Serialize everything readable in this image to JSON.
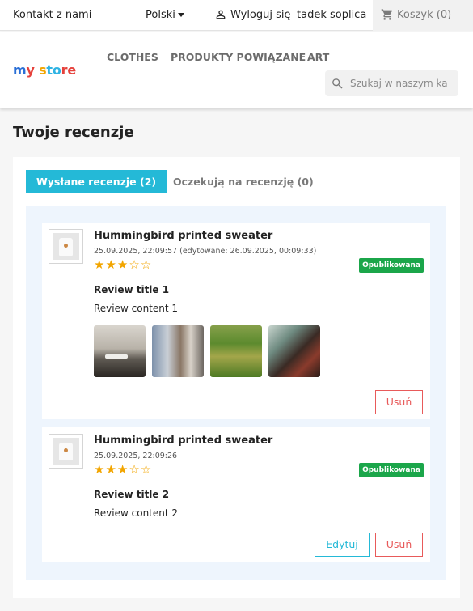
{
  "topnav": {
    "contact": "Kontakt z nami",
    "language": "Polski",
    "logout": "Wyloguj się",
    "username": "tadek soplica",
    "cart": "Koszyk (0)"
  },
  "header": {
    "logo": {
      "w1": "m",
      "w2": "y",
      "w3": "s",
      "w4": "to",
      "w5": "re"
    },
    "menu": [
      "CLOTHES",
      "PRODUKTY POWIĄZANE",
      "ART"
    ],
    "search_placeholder": "Szukaj w naszym ka"
  },
  "page": {
    "title": "Twoje recenzje"
  },
  "tabs": [
    {
      "label": "Wysłane recenzje (2)",
      "active": true
    },
    {
      "label": "Oczekują na recenzję (0)",
      "active": false
    }
  ],
  "reviews": [
    {
      "product": "Hummingbird printed sweater",
      "date": "25.09.2025, 22:09:57 (edytowane: 26.09.2025, 00:09:33)",
      "rating": 3,
      "rating_max": 5,
      "status": "Opublikowana",
      "review_title": "Review title 1",
      "review_content": "Review content 1",
      "photos": 4,
      "actions": {
        "delete": "Usuń"
      }
    },
    {
      "product": "Hummingbird printed sweater",
      "date": "25.09.2025, 22:09:26",
      "rating": 3,
      "rating_max": 5,
      "status": "Opublikowana",
      "review_title": "Review title 2",
      "review_content": "Review content 2",
      "photos": 0,
      "actions": {
        "edit": "Edytuj",
        "delete": "Usuń"
      }
    }
  ],
  "colors": {
    "accent": "#24b9d7",
    "success": "#1ba64a",
    "danger": "#e85a5a",
    "star": "#f2a500",
    "panel_bg": "#eef5fd"
  },
  "icons": {
    "user": "user-icon",
    "cart": "cart-icon",
    "search": "search-icon",
    "language_dropdown": "chevron-down-icon",
    "star": "star-icon"
  }
}
